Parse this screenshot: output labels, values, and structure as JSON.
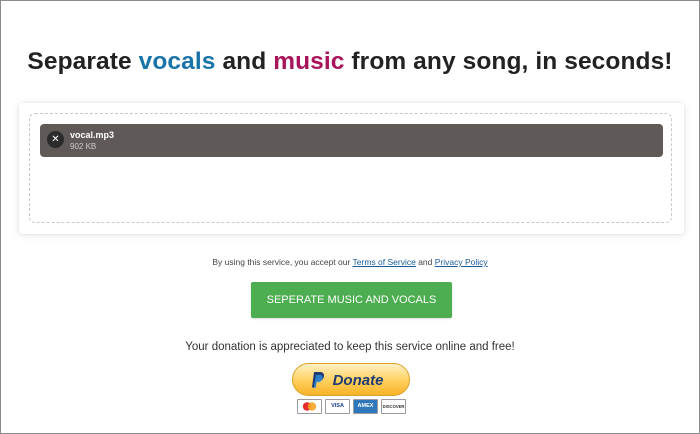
{
  "headline": {
    "pre": "Separate ",
    "word_vocals": "vocals",
    "mid": " and ",
    "word_music": "music",
    "post": " from any song, in seconds!",
    "colors": {
      "vocals": "#1a74a8",
      "music": "#a8145a",
      "text": "#222222"
    }
  },
  "upload": {
    "file": {
      "name": "vocal.mp3",
      "size": "902 KB",
      "remove_icon": "close-icon",
      "remove_glyph": "✕"
    }
  },
  "terms": {
    "prefix": "By using this service, you accept our ",
    "tos_link": "Terms of Service",
    "middle": " and ",
    "privacy_link": "Privacy Policy"
  },
  "action": {
    "button_label": "SEPERATE MUSIC AND VOCALS",
    "color": "#4cae50"
  },
  "donation": {
    "message": "Your donation is appreciated to keep this service online and free!",
    "button_label": "Donate",
    "logo": "paypal-logo-icon",
    "card_icons": [
      {
        "name": "mastercard-icon",
        "label": "MC"
      },
      {
        "name": "visa-icon",
        "label": "VISA"
      },
      {
        "name": "amex-icon",
        "label": "AMEX"
      },
      {
        "name": "discover-icon",
        "label": "DISCOVER"
      }
    ]
  }
}
